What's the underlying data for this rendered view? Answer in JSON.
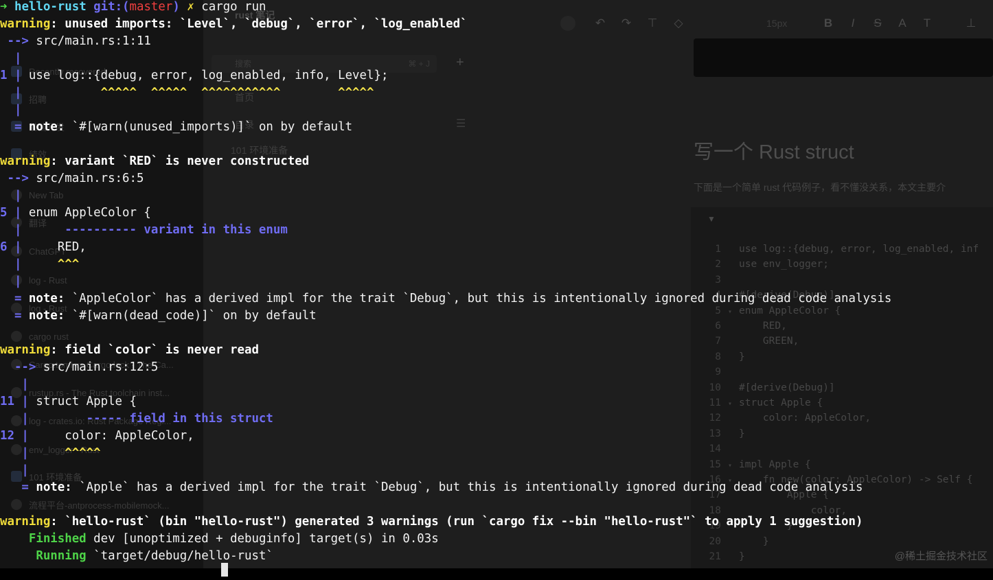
{
  "sidebar": {
    "items": [
      {
        "label": "Recently recovered",
        "icon": "folder-icon"
      },
      {
        "label": "招聘",
        "icon": "folder-icon"
      },
      {
        "label": "前端开发",
        "icon": "folder-icon"
      },
      {
        "label": "绩效",
        "icon": "folder-icon"
      },
      {
        "label": "New Tab",
        "icon": "plus-icon"
      },
      {
        "label": "翻译",
        "icon": "globe-icon"
      },
      {
        "label": "ChatGPT",
        "icon": "chat-icon"
      },
      {
        "label": "log - Rust",
        "icon": "page-icon"
      },
      {
        "label": "log - Rust",
        "icon": "page-icon"
      },
      {
        "label": "cargo rust",
        "icon": "google-icon"
      },
      {
        "label": "Cargo.toml vs Cargo.lock - The Ca...",
        "icon": "cargo-icon"
      },
      {
        "label": "rustup.rs - The Rust toolchain inst...",
        "icon": "rust-icon"
      },
      {
        "label": "log - crates.io: Rust Package Regi...",
        "icon": "crates-icon"
      },
      {
        "label": "env_logger - Rust",
        "icon": "page-icon"
      },
      {
        "label": "101 环境准备",
        "icon": "doc-icon"
      },
      {
        "label": "流程平台-antprocess-mobilemock...",
        "icon": "page-icon"
      }
    ]
  },
  "editor": {
    "tab_title": "rust 笔记",
    "toolbar": {
      "font_size": "15px"
    },
    "nav": {
      "search_placeholder": "搜索",
      "shortcut": "⌘ + J",
      "home": "首页",
      "toc": "目录",
      "toc_item": "101 环境准备"
    },
    "doc_title": "写一个 Rust struct",
    "doc_intro": "下面是一个简单 rust 代码例子，看不懂没关系，本文主要介",
    "code_lines": [
      {
        "n": "1",
        "fold": "",
        "text": "use log::{debug, error, log_enabled, inf"
      },
      {
        "n": "2",
        "fold": "",
        "text": "use env_logger;"
      },
      {
        "n": "3",
        "fold": "",
        "text": ""
      },
      {
        "n": "4",
        "fold": "",
        "text": "#[derive(Debug)]"
      },
      {
        "n": "5",
        "fold": "▾",
        "text": "enum AppleColor {"
      },
      {
        "n": "6",
        "fold": "",
        "text": "    RED,"
      },
      {
        "n": "7",
        "fold": "",
        "text": "    GREEN,"
      },
      {
        "n": "8",
        "fold": "",
        "text": "}"
      },
      {
        "n": "9",
        "fold": "",
        "text": ""
      },
      {
        "n": "10",
        "fold": "",
        "text": "#[derive(Debug)]"
      },
      {
        "n": "11",
        "fold": "▾",
        "text": "struct Apple {"
      },
      {
        "n": "12",
        "fold": "",
        "text": "    color: AppleColor,"
      },
      {
        "n": "13",
        "fold": "",
        "text": "}"
      },
      {
        "n": "14",
        "fold": "",
        "text": ""
      },
      {
        "n": "15",
        "fold": "▾",
        "text": "impl Apple {"
      },
      {
        "n": "16",
        "fold": "▾",
        "text": "    fn new(color: AppleColor) -> Self {"
      },
      {
        "n": "17",
        "fold": "",
        "text": "        Apple {"
      },
      {
        "n": "18",
        "fold": "",
        "text": "            color,"
      },
      {
        "n": "19",
        "fold": "",
        "text": "        }"
      },
      {
        "n": "20",
        "fold": "",
        "text": "    }"
      },
      {
        "n": "21",
        "fold": "",
        "text": "}"
      }
    ]
  },
  "watermark": "@稀土掘金技术社区",
  "terminal": {
    "prompt_arrow": "➜",
    "prompt_dir": "hello-rust",
    "prompt_git": "git:(",
    "prompt_branch": "master",
    "prompt_git_close": ")",
    "prompt_dirty": "✗",
    "command": "cargo run",
    "w1_label": "warning",
    "w1_msg": ": unused imports: `Level`, `debug`, `error`, `log_enabled`",
    "w1_loc": "src/main.rs:1:11",
    "w1_code_no": "1",
    "w1_code": "use log::{debug, error, log_enabled, info, Level};",
    "w1_marks": "          ^^^^^  ^^^^^  ^^^^^^^^^^^        ^^^^^",
    "w1_note": "`#[warn(unused_imports)]` on by default",
    "w2_label": "warning",
    "w2_msg": ": variant `RED` is never constructed",
    "w2_loc": "src/main.rs:6:5",
    "w2_l1_no": "5",
    "w2_l1": "enum AppleColor {",
    "w2_l1_mark": "     ---------- variant in this enum",
    "w2_l2_no": "6",
    "w2_l2": "    RED,",
    "w2_l2_mark": "    ^^^",
    "w2_note1": "`AppleColor` has a derived impl for the trait `Debug`, but this is intentionally ignored during dead code analysis",
    "w2_note2": "`#[warn(dead_code)]` on by default",
    "w3_label": "warning",
    "w3_msg": ": field `color` is never read",
    "w3_loc": "src/main.rs:12:5",
    "w3_l1_no": "11",
    "w3_l1": "struct Apple {",
    "w3_l1_mark": "       ----- field in this struct",
    "w3_l2_no": "12",
    "w3_l2": "    color: AppleColor,",
    "w3_l2_mark": "    ^^^^^",
    "w3_note": "`Apple` has a derived impl for the trait `Debug`, but this is intentionally ignored during dead code analysis",
    "note_label": "note",
    "summary_label": "warning",
    "summary": ": `hello-rust` (bin \"hello-rust\") generated 3 warnings (run `cargo fix --bin \"hello-rust\"` to apply 1 suggestion)",
    "finished_label": "Finished",
    "finished": "dev [unoptimized + debuginfo] target(s) in 0.03s",
    "running_label": "Running",
    "running": "`target/debug/hello-rust`"
  }
}
